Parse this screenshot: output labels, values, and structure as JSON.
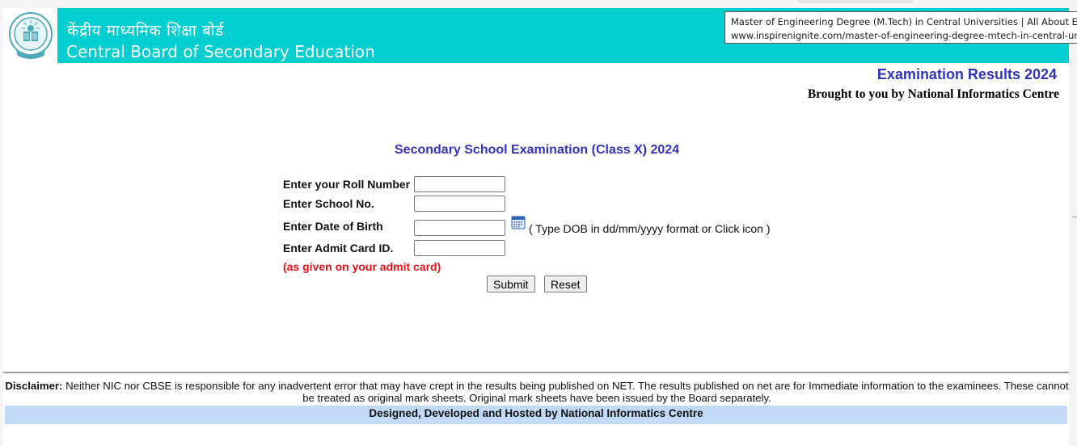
{
  "header": {
    "logo_alt": "CBSE emblem",
    "hindi_title": "केंद्रीय माध्यमिक शिक्षा बोर्ड",
    "english_title": "Central Board of Secondary Education",
    "banner_color": "#00ced1",
    "banner_url_peek": "http://cbseresults.nic.in"
  },
  "tooltip": {
    "title": "Master of Engineering Degree (M.Tech) in Central Universities | All About Education",
    "url": "www.inspirenignite.com/master-of-engineering-degree-mtech-in-central-universities"
  },
  "subheader": {
    "exam_results": "Examination Results 2024",
    "brought_by": "Brought to you by National Informatics Centre"
  },
  "form": {
    "title": "Secondary School Examination (Class X) 2024",
    "fields": [
      {
        "label": "Enter your Roll Number",
        "value": ""
      },
      {
        "label": "Enter School No.",
        "value": ""
      },
      {
        "label": "Enter Date of Birth",
        "value": "",
        "hint": "( Type DOB in dd/mm/yyyy format or Click icon )",
        "icon": "calendar-icon"
      },
      {
        "label": "Enter Admit Card ID.",
        "value": ""
      }
    ],
    "admit_note": "(as given on your admit card)",
    "submit_label": "Submit",
    "reset_label": "Reset"
  },
  "footer": {
    "disclaimer_label": "Disclaimer:",
    "disclaimer_text": " Neither NIC nor CBSE is responsible for any inadvertent error that may have crept in the results being published on NET. The results published on net are for Immediate information to the examinees. These cannot be treated as original mark sheets. Original mark sheets have been issued by the Board separately.",
    "credits": "Designed, Developed and Hosted by National Informatics Centre"
  },
  "colors": {
    "heading_blue": "#3333bb",
    "note_red": "#e8111b",
    "footer_bar": "#c1d9f5"
  }
}
